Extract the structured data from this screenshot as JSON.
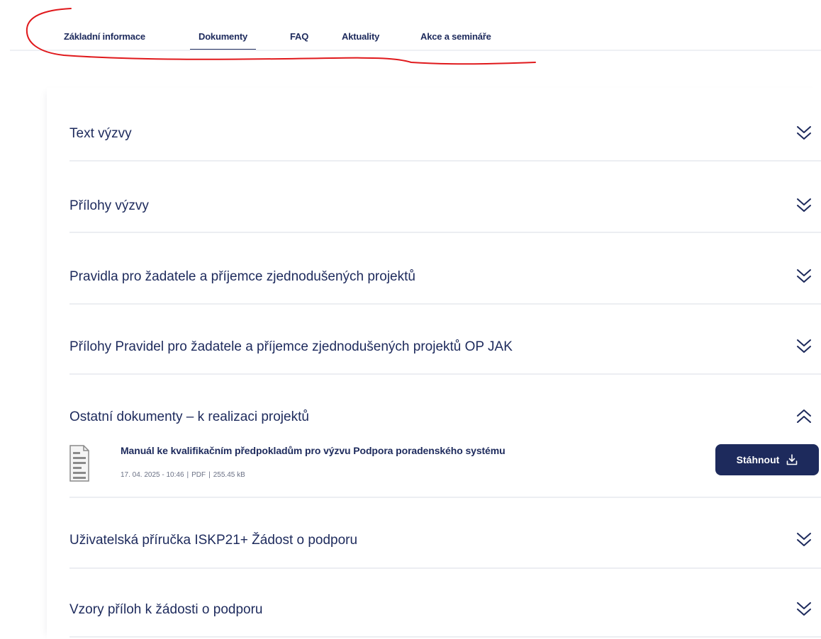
{
  "tabs": [
    {
      "label": "Základní informace",
      "active": false
    },
    {
      "label": "Dokumenty",
      "active": true
    },
    {
      "label": "FAQ",
      "active": false
    },
    {
      "label": "Aktuality",
      "active": false
    },
    {
      "label": "Akce a semináře",
      "active": false
    }
  ],
  "sections": [
    {
      "title": "Text výzvy",
      "expanded": false,
      "icon": "chevron-down-double-icon"
    },
    {
      "title": "Přílohy výzvy",
      "expanded": false,
      "icon": "chevron-down-double-icon"
    },
    {
      "title": "Pravidla pro žadatele a příjemce zjednodušených projektů",
      "expanded": false,
      "icon": "chevron-down-double-icon"
    },
    {
      "title": "Přílohy Pravidel pro žadatele a příjemce zjednodušených projektů OP JAK",
      "expanded": false,
      "icon": "chevron-down-double-icon"
    },
    {
      "title": "Ostatní dokumenty – k realizaci projektů",
      "expanded": true,
      "icon": "chevron-up-double-icon"
    },
    {
      "title": "Uživatelská příručka ISKP21+ Žádost o podporu",
      "expanded": false,
      "icon": "chevron-down-double-icon"
    },
    {
      "title": "Vzory příloh k žádosti o podporu",
      "expanded": false,
      "icon": "chevron-down-double-icon"
    }
  ],
  "document": {
    "title": "Manuál ke kvalifikačním předpokladům pro výzvu Podpora poradenského systému",
    "date": "17. 04. 2025 - 10:46",
    "format": "PDF",
    "size": "255.45 kB",
    "download_label": "Stáhnout",
    "icon": "document-icon"
  },
  "colors": {
    "primary": "#1d2a5c",
    "annotation": "#e0191c",
    "separator": "#eceef2"
  }
}
